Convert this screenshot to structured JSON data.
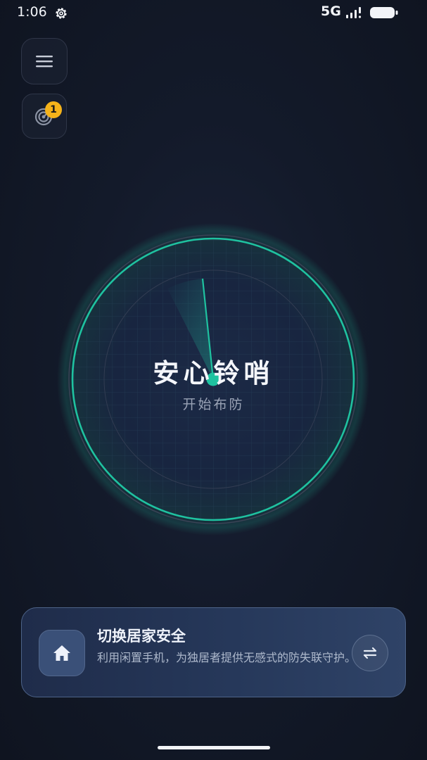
{
  "status_bar": {
    "time": "1:06",
    "network": "5G",
    "icons": [
      "gear-icon",
      "signal-icon",
      "battery-icon"
    ]
  },
  "side_buttons": {
    "menu_icon": "menu-icon",
    "radar_icon": "radar-icon",
    "radar_badge": "1"
  },
  "radar": {
    "title": "安心铃哨",
    "subtitle": "开始布防"
  },
  "card": {
    "icon": "home-icon",
    "title": "切换居家安全",
    "description": "利用闲置手机，为独居者提供无感式的防失联守护。",
    "switch_icon": "swap-arrows-icon"
  },
  "colors": {
    "accent": "#1fc2a0",
    "badge": "#f5b31a",
    "background": "#10141f",
    "card": "#26385a"
  }
}
